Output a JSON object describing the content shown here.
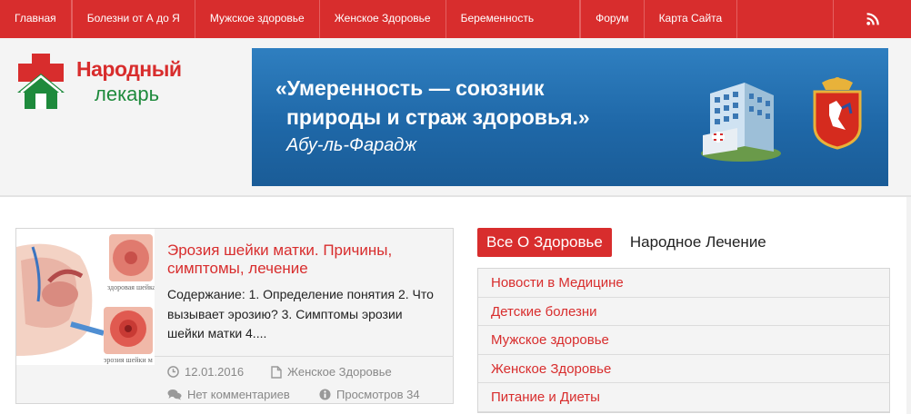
{
  "nav": {
    "items": [
      {
        "label": "Главная"
      },
      {
        "label": "Болезни от А до Я"
      },
      {
        "label": "Мужское здоровье"
      },
      {
        "label": "Женское Здоровье"
      },
      {
        "label": "Беременность"
      },
      {
        "label": "Форум"
      },
      {
        "label": "Карта Сайта"
      }
    ],
    "rss_icon": "rss-icon"
  },
  "header": {
    "logo_line1": "Народный",
    "logo_line2": "лекарь",
    "banner_quote_line1": "«Умеренность — союзник",
    "banner_quote_line2": "природы и страж здоровья.»",
    "banner_author": "Абу-ль-Фарадж"
  },
  "article": {
    "title": "Эрозия шейки матки. Причины, симптомы, лечение",
    "excerpt": "Содержание: 1. Определение понятия 2. Что вызывает эрозию? 3. Симптомы эрозии шейки матки 4....",
    "date": "12.01.2016",
    "category": "Женское Здоровье",
    "comments": "Нет комментариев",
    "views": "Просмотров 34",
    "thumb_caption1": "здоровая шейка м",
    "thumb_caption2": "эрозия шейки м"
  },
  "sidebar": {
    "tabs": [
      {
        "label": "Все О Здоровье"
      },
      {
        "label": "Народное Лечение"
      }
    ],
    "categories": [
      {
        "label": "Новости в Медицине"
      },
      {
        "label": "Детские болезни"
      },
      {
        "label": "Мужское здоровье"
      },
      {
        "label": "Женское Здоровье"
      },
      {
        "label": "Питание и Диеты"
      }
    ]
  },
  "colors": {
    "accent": "#d82d2d",
    "logo_green": "#1e8a3c",
    "banner_blue": "#1f68a8"
  }
}
